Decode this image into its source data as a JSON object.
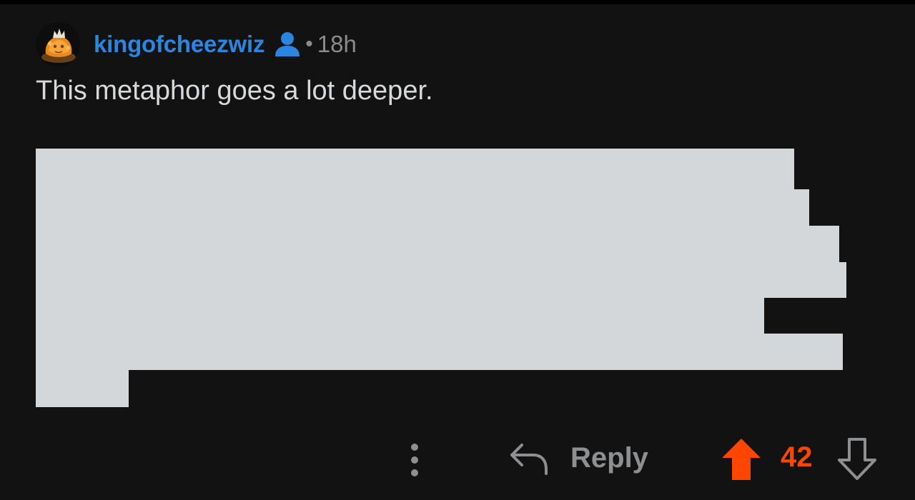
{
  "comment": {
    "username": "kingofcheezwiz",
    "separator": "•",
    "timestamp": "18h",
    "body": "This metaphor goes a lot deeper.",
    "redacted_block": "redacted image content"
  },
  "actions": {
    "reply_label": "Reply",
    "score": "42",
    "upvote_state": "upvoted"
  },
  "icons": {
    "avatar": "avatar-icon",
    "user": "user-icon",
    "more": "more-vertical-icon",
    "reply": "reply-arrow-icon",
    "upvote": "upvote-arrow-icon",
    "downvote": "downvote-arrow-icon"
  },
  "colors": {
    "background": "#121212",
    "username": "#2a86e0",
    "muted_text": "#8b8b8b",
    "body_text": "#d7d9da",
    "upvote_active": "#ff4500",
    "redaction": "#d4d7da"
  }
}
